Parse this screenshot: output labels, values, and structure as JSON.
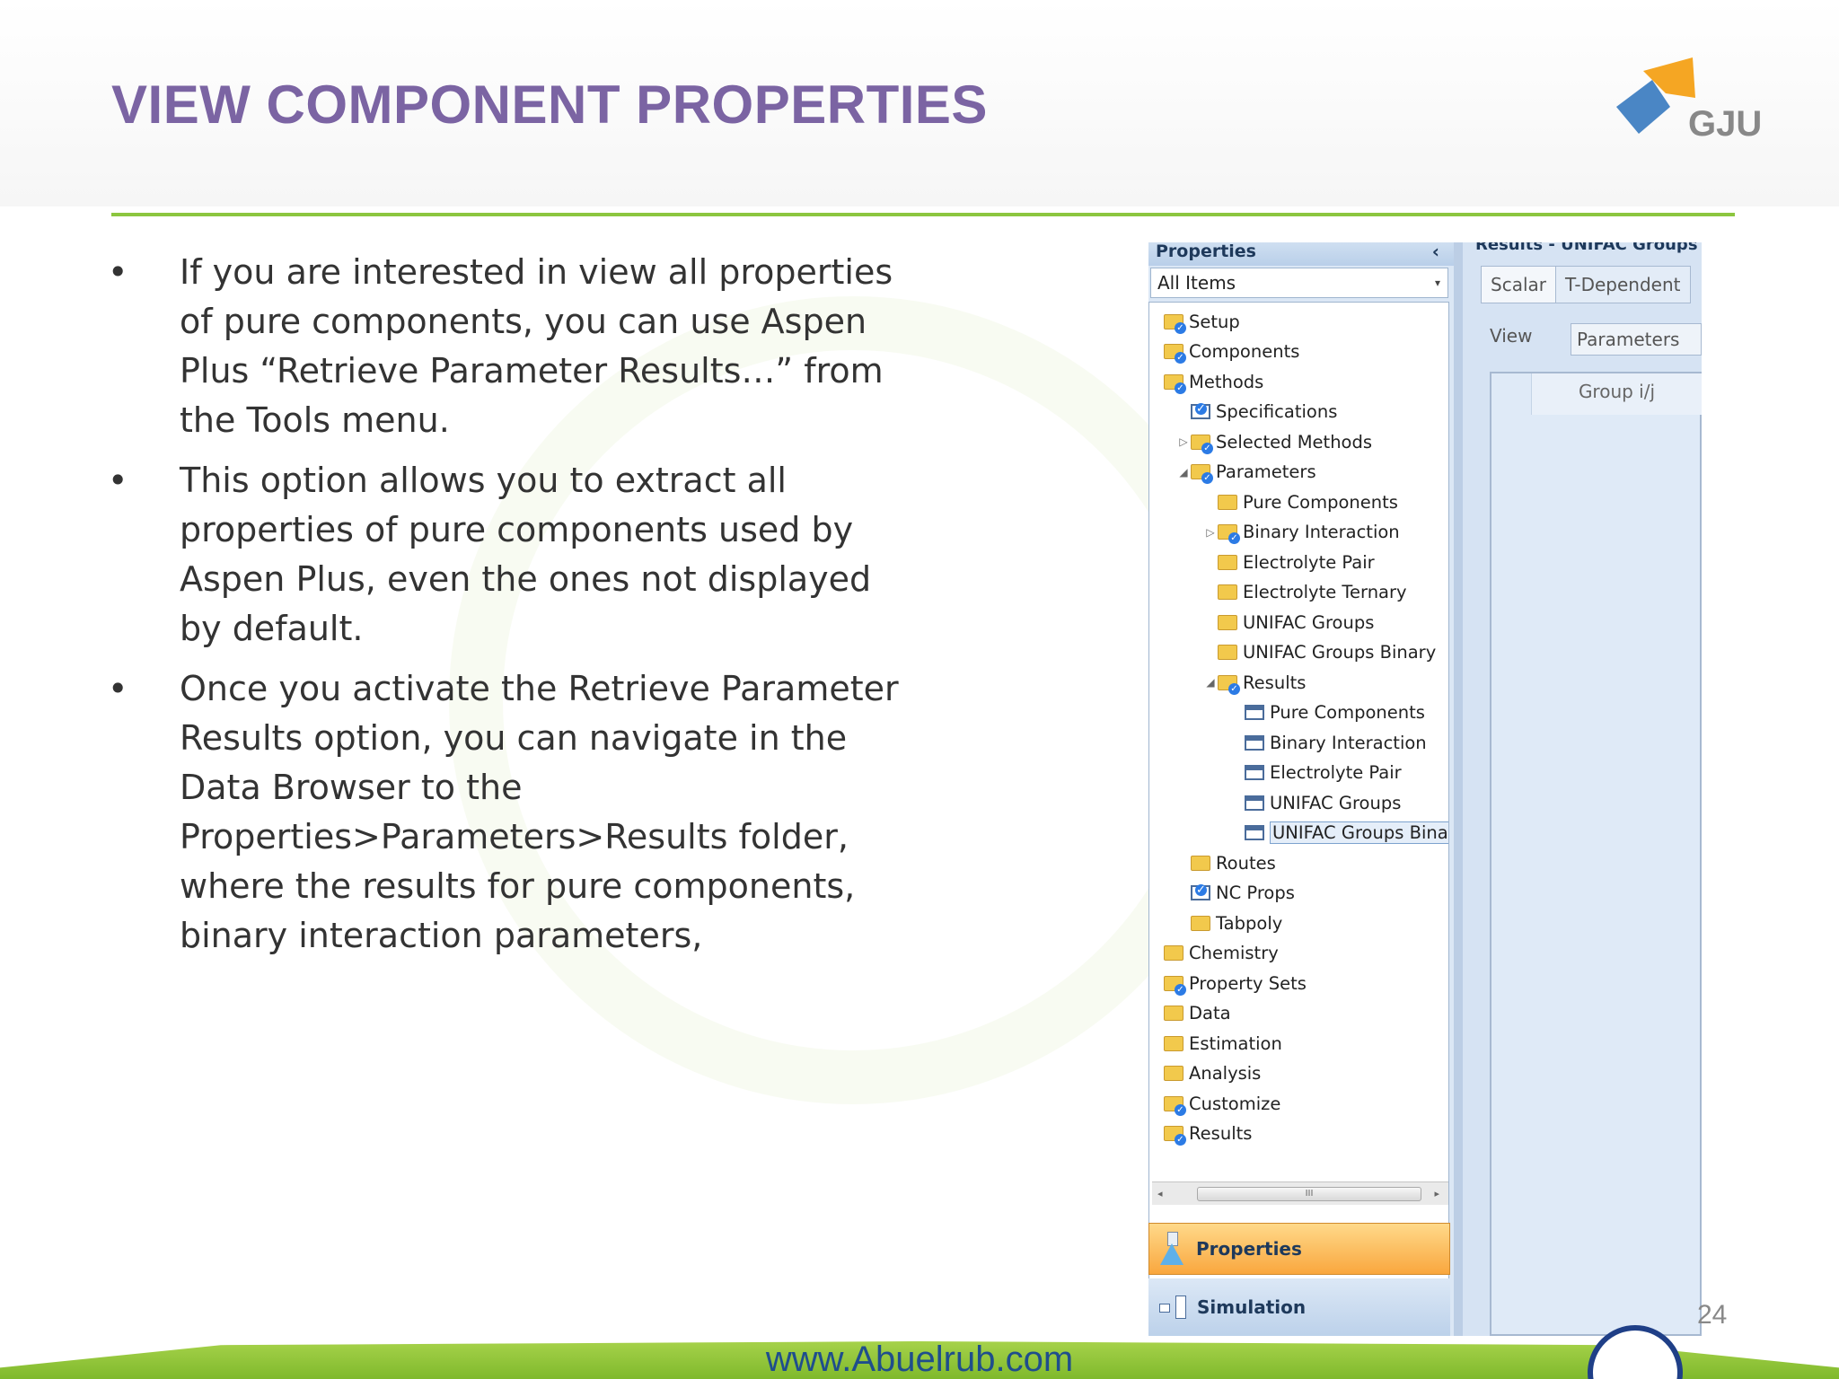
{
  "slide": {
    "title": "VIEW COMPONENT PROPERTIES",
    "logo_text": "GJU",
    "page_number": "24",
    "footer_url": "www.Abuelrub.com",
    "bullets": [
      "If you are interested in view all properties of pure components, you can use Aspen Plus “Retrieve Parameter Results…” from the Tools menu.",
      "This option allows you to extract all properties of pure components used by Aspen Plus, even the ones not displayed by default.",
      "Once you activate the Retrieve Parameter Results option, you can navigate in the Data Browser to the Properties>Parameters>Results folder, where the results for pure components, binary interaction parameters,"
    ]
  },
  "screenshot": {
    "nav_title": "Properties",
    "filter_value": "All Items",
    "tree": [
      {
        "label": "Setup",
        "level": 0,
        "icon": "folder-check-icon",
        "arrow": ""
      },
      {
        "label": "Components",
        "level": 0,
        "icon": "folder-check-icon",
        "arrow": ""
      },
      {
        "label": "Methods",
        "level": 0,
        "icon": "folder-check-icon",
        "arrow": ""
      },
      {
        "label": "Specifications",
        "level": 1,
        "icon": "checkbox-form-icon",
        "arrow": ""
      },
      {
        "label": "Selected Methods",
        "level": 1,
        "icon": "folder-check-icon",
        "arrow": "▷"
      },
      {
        "label": "Parameters",
        "level": 1,
        "icon": "folder-check-icon",
        "arrow": "◢"
      },
      {
        "label": "Pure Components",
        "level": 2,
        "icon": "folder-icon",
        "arrow": ""
      },
      {
        "label": "Binary Interaction",
        "level": 2,
        "icon": "folder-check-icon",
        "arrow": "▷"
      },
      {
        "label": "Electrolyte Pair",
        "level": 2,
        "icon": "folder-icon",
        "arrow": ""
      },
      {
        "label": "Electrolyte Ternary",
        "level": 2,
        "icon": "folder-icon",
        "arrow": ""
      },
      {
        "label": "UNIFAC Groups",
        "level": 2,
        "icon": "folder-icon",
        "arrow": ""
      },
      {
        "label": "UNIFAC Groups Binary",
        "level": 2,
        "icon": "folder-icon",
        "arrow": ""
      },
      {
        "label": "Results",
        "level": 2,
        "icon": "folder-check-icon",
        "arrow": "◢"
      },
      {
        "label": "Pure Components",
        "level": 3,
        "icon": "form-icon",
        "arrow": ""
      },
      {
        "label": "Binary Interaction",
        "level": 3,
        "icon": "form-icon",
        "arrow": ""
      },
      {
        "label": "Electrolyte Pair",
        "level": 3,
        "icon": "form-icon",
        "arrow": ""
      },
      {
        "label": "UNIFAC Groups",
        "level": 3,
        "icon": "form-icon",
        "arrow": ""
      },
      {
        "label": "UNIFAC Groups Binary",
        "level": 3,
        "icon": "form-icon",
        "arrow": "",
        "selected": true
      },
      {
        "label": "Routes",
        "level": 1,
        "icon": "folder-icon",
        "arrow": ""
      },
      {
        "label": "NC Props",
        "level": 1,
        "icon": "checkbox-form-icon",
        "arrow": ""
      },
      {
        "label": "Tabpoly",
        "level": 1,
        "icon": "folder-icon",
        "arrow": ""
      },
      {
        "label": "Chemistry",
        "level": 0,
        "icon": "folder-icon",
        "arrow": ""
      },
      {
        "label": "Property Sets",
        "level": 0,
        "icon": "folder-check-icon",
        "arrow": ""
      },
      {
        "label": "Data",
        "level": 0,
        "icon": "folder-icon",
        "arrow": ""
      },
      {
        "label": "Estimation",
        "level": 0,
        "icon": "folder-icon",
        "arrow": ""
      },
      {
        "label": "Analysis",
        "level": 0,
        "icon": "folder-icon",
        "arrow": ""
      },
      {
        "label": "Customize",
        "level": 0,
        "icon": "folder-check-icon",
        "arrow": ""
      },
      {
        "label": "Results",
        "level": 0,
        "icon": "folder-check-icon",
        "arrow": ""
      }
    ],
    "scroll_thumb_label": "III",
    "properties_button": "Properties",
    "simulation_button": "Simulation",
    "right_header": "Results - UNIFAC Groups",
    "tabs": [
      "Scalar",
      "T-Dependent"
    ],
    "view_label": "View",
    "view_value": "Parameters",
    "grid_column": "Group i/j"
  },
  "colors": {
    "title": "#7b64a3",
    "divider": "#8cc63f",
    "properties_button": "#f9a73e",
    "footer_url": "#1f4e8c"
  }
}
